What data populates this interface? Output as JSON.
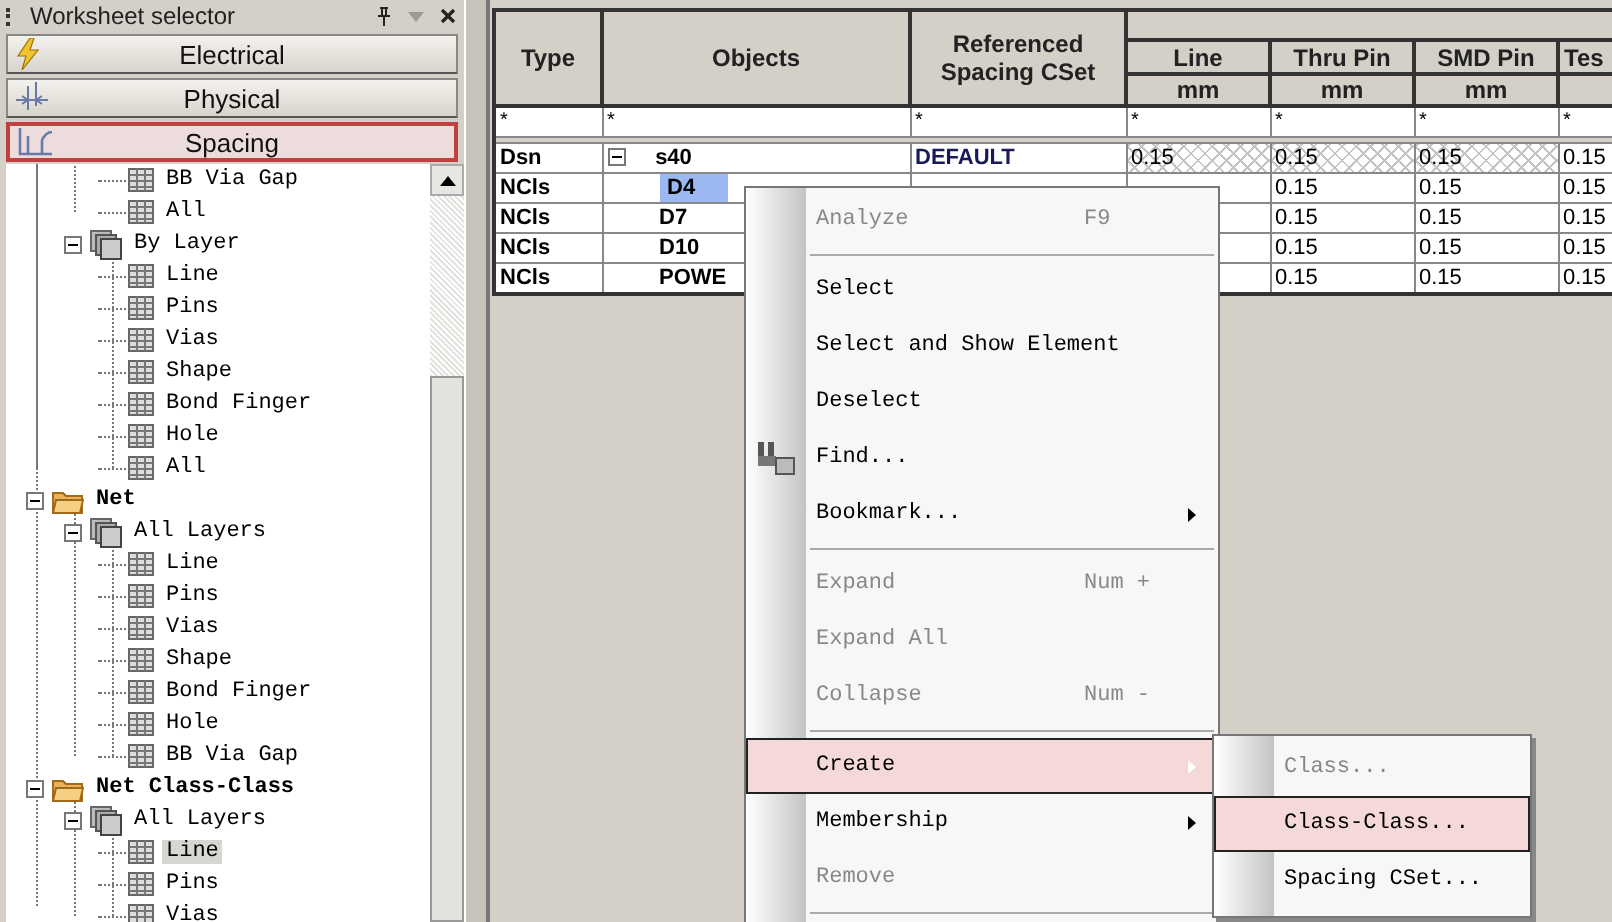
{
  "selector": {
    "title": "Worksheet selector",
    "categories": [
      {
        "label": "Electrical",
        "kind": "electrical",
        "selected": false
      },
      {
        "label": "Physical",
        "kind": "physical",
        "selected": false
      },
      {
        "label": "Spacing",
        "kind": "spacing",
        "selected": true
      }
    ],
    "tree": [
      {
        "children": [
          {
            "children": [
              {
                "label": "BB Via Gap",
                "kind": "sheet",
                "selected": false
              },
              {
                "label": "All",
                "kind": "sheet",
                "selected": false
              }
            ]
          },
          {
            "label": "By Layer",
            "kind": "layers",
            "expanded": true,
            "children": [
              {
                "label": "Line",
                "kind": "sheet",
                "selected": false
              },
              {
                "label": "Pins",
                "kind": "sheet",
                "selected": false
              },
              {
                "label": "Vias",
                "kind": "sheet",
                "selected": false
              },
              {
                "label": "Shape",
                "kind": "sheet",
                "selected": false
              },
              {
                "label": "Bond Finger",
                "kind": "sheet",
                "selected": false
              },
              {
                "label": "Hole",
                "kind": "sheet",
                "selected": false
              },
              {
                "label": "All",
                "kind": "sheet",
                "selected": false
              }
            ]
          }
        ]
      },
      {
        "label": "Net",
        "kind": "folder",
        "expanded": true,
        "children": [
          {
            "label": "All Layers",
            "kind": "layers",
            "expanded": true,
            "children": [
              {
                "label": "Line",
                "kind": "sheet",
                "selected": false
              },
              {
                "label": "Pins",
                "kind": "sheet",
                "selected": false
              },
              {
                "label": "Vias",
                "kind": "sheet",
                "selected": false
              },
              {
                "label": "Shape",
                "kind": "sheet",
                "selected": false
              },
              {
                "label": "Bond Finger",
                "kind": "sheet",
                "selected": false
              },
              {
                "label": "Hole",
                "kind": "sheet",
                "selected": false
              },
              {
                "label": "BB Via Gap",
                "kind": "sheet",
                "selected": false
              }
            ]
          }
        ]
      },
      {
        "label": "Net Class-Class",
        "kind": "folder",
        "expanded": true,
        "children": [
          {
            "label": "All Layers",
            "kind": "layers",
            "expanded": true,
            "children": [
              {
                "label": "Line",
                "kind": "sheet",
                "selected": true
              },
              {
                "label": "Pins",
                "kind": "sheet",
                "selected": false
              },
              {
                "label": "Vias",
                "kind": "sheet",
                "selected": false
              }
            ]
          }
        ]
      }
    ]
  },
  "table": {
    "columns": [
      {
        "label": "Type",
        "filter": "*"
      },
      {
        "label": "Objects",
        "filter": "*"
      },
      {
        "label": "Referenced Spacing CSet",
        "filter": "*"
      },
      {
        "label": "Line",
        "unit": "mm",
        "filter": "*"
      },
      {
        "label": "Thru Pin",
        "unit": "mm",
        "filter": "*"
      },
      {
        "label": "SMD Pin",
        "unit": "mm",
        "filter": "*"
      },
      {
        "label": "Tes",
        "filter": "*"
      }
    ],
    "rows": [
      {
        "type": "Dsn",
        "object": "s40",
        "expanded": true,
        "selected": false,
        "cset": "DEFAULT",
        "line": "0.15",
        "thru_pin": "0.15",
        "smd_pin": "0.15",
        "tes": "0.15",
        "hatched": true
      },
      {
        "type": "NCls",
        "object": "D4",
        "selected": true,
        "thru_pin": "0.15",
        "smd_pin": "0.15",
        "tes": "0.15"
      },
      {
        "type": "NCls",
        "object": "D7",
        "selected": false,
        "thru_pin": "0.15",
        "smd_pin": "0.15",
        "tes": "0.15"
      },
      {
        "type": "NCls",
        "object": "D10",
        "selected": false,
        "thru_pin": "0.15",
        "smd_pin": "0.15",
        "tes": "0.15"
      },
      {
        "type": "NCls",
        "object": "POWE",
        "selected": false,
        "thru_pin": "0.15",
        "smd_pin": "0.15",
        "tes": "0.15"
      }
    ]
  },
  "context_menu": {
    "items": [
      {
        "kind": "item",
        "label": "Analyze",
        "shortcut": "F9",
        "disabled": true,
        "selected": false,
        "submenu": false
      },
      {
        "kind": "separator"
      },
      {
        "kind": "item",
        "label": "Select",
        "disabled": false,
        "selected": false,
        "submenu": false
      },
      {
        "kind": "item",
        "label": "Select and Show Element",
        "disabled": false,
        "selected": false,
        "submenu": false
      },
      {
        "kind": "item",
        "label": "Deselect",
        "disabled": false,
        "selected": false,
        "submenu": false
      },
      {
        "kind": "item",
        "label": "Find...",
        "disabled": false,
        "selected": false,
        "submenu": false,
        "icon": true
      },
      {
        "kind": "item",
        "label": "Bookmark...",
        "disabled": false,
        "selected": false,
        "submenu": true
      },
      {
        "kind": "separator"
      },
      {
        "kind": "item",
        "label": "Expand",
        "shortcut": "Num +",
        "disabled": true,
        "selected": false,
        "submenu": false
      },
      {
        "kind": "item",
        "label": "Expand All",
        "disabled": true,
        "selected": false,
        "submenu": false
      },
      {
        "kind": "item",
        "label": "Collapse",
        "shortcut": "Num -",
        "disabled": true,
        "selected": false,
        "submenu": false
      },
      {
        "kind": "separator"
      },
      {
        "kind": "item",
        "label": "Create",
        "disabled": false,
        "selected": true,
        "submenu": true
      },
      {
        "kind": "item",
        "label": "Membership",
        "disabled": false,
        "selected": false,
        "submenu": true
      },
      {
        "kind": "item",
        "label": "Remove",
        "disabled": true,
        "selected": false,
        "submenu": false
      },
      {
        "kind": "separator"
      }
    ]
  },
  "submenu": {
    "items": [
      {
        "label": "Class...",
        "disabled": true,
        "selected": false
      },
      {
        "label": "Class-Class...",
        "disabled": false,
        "selected": true
      },
      {
        "label": "Spacing CSet...",
        "disabled": false,
        "selected": false
      }
    ]
  }
}
